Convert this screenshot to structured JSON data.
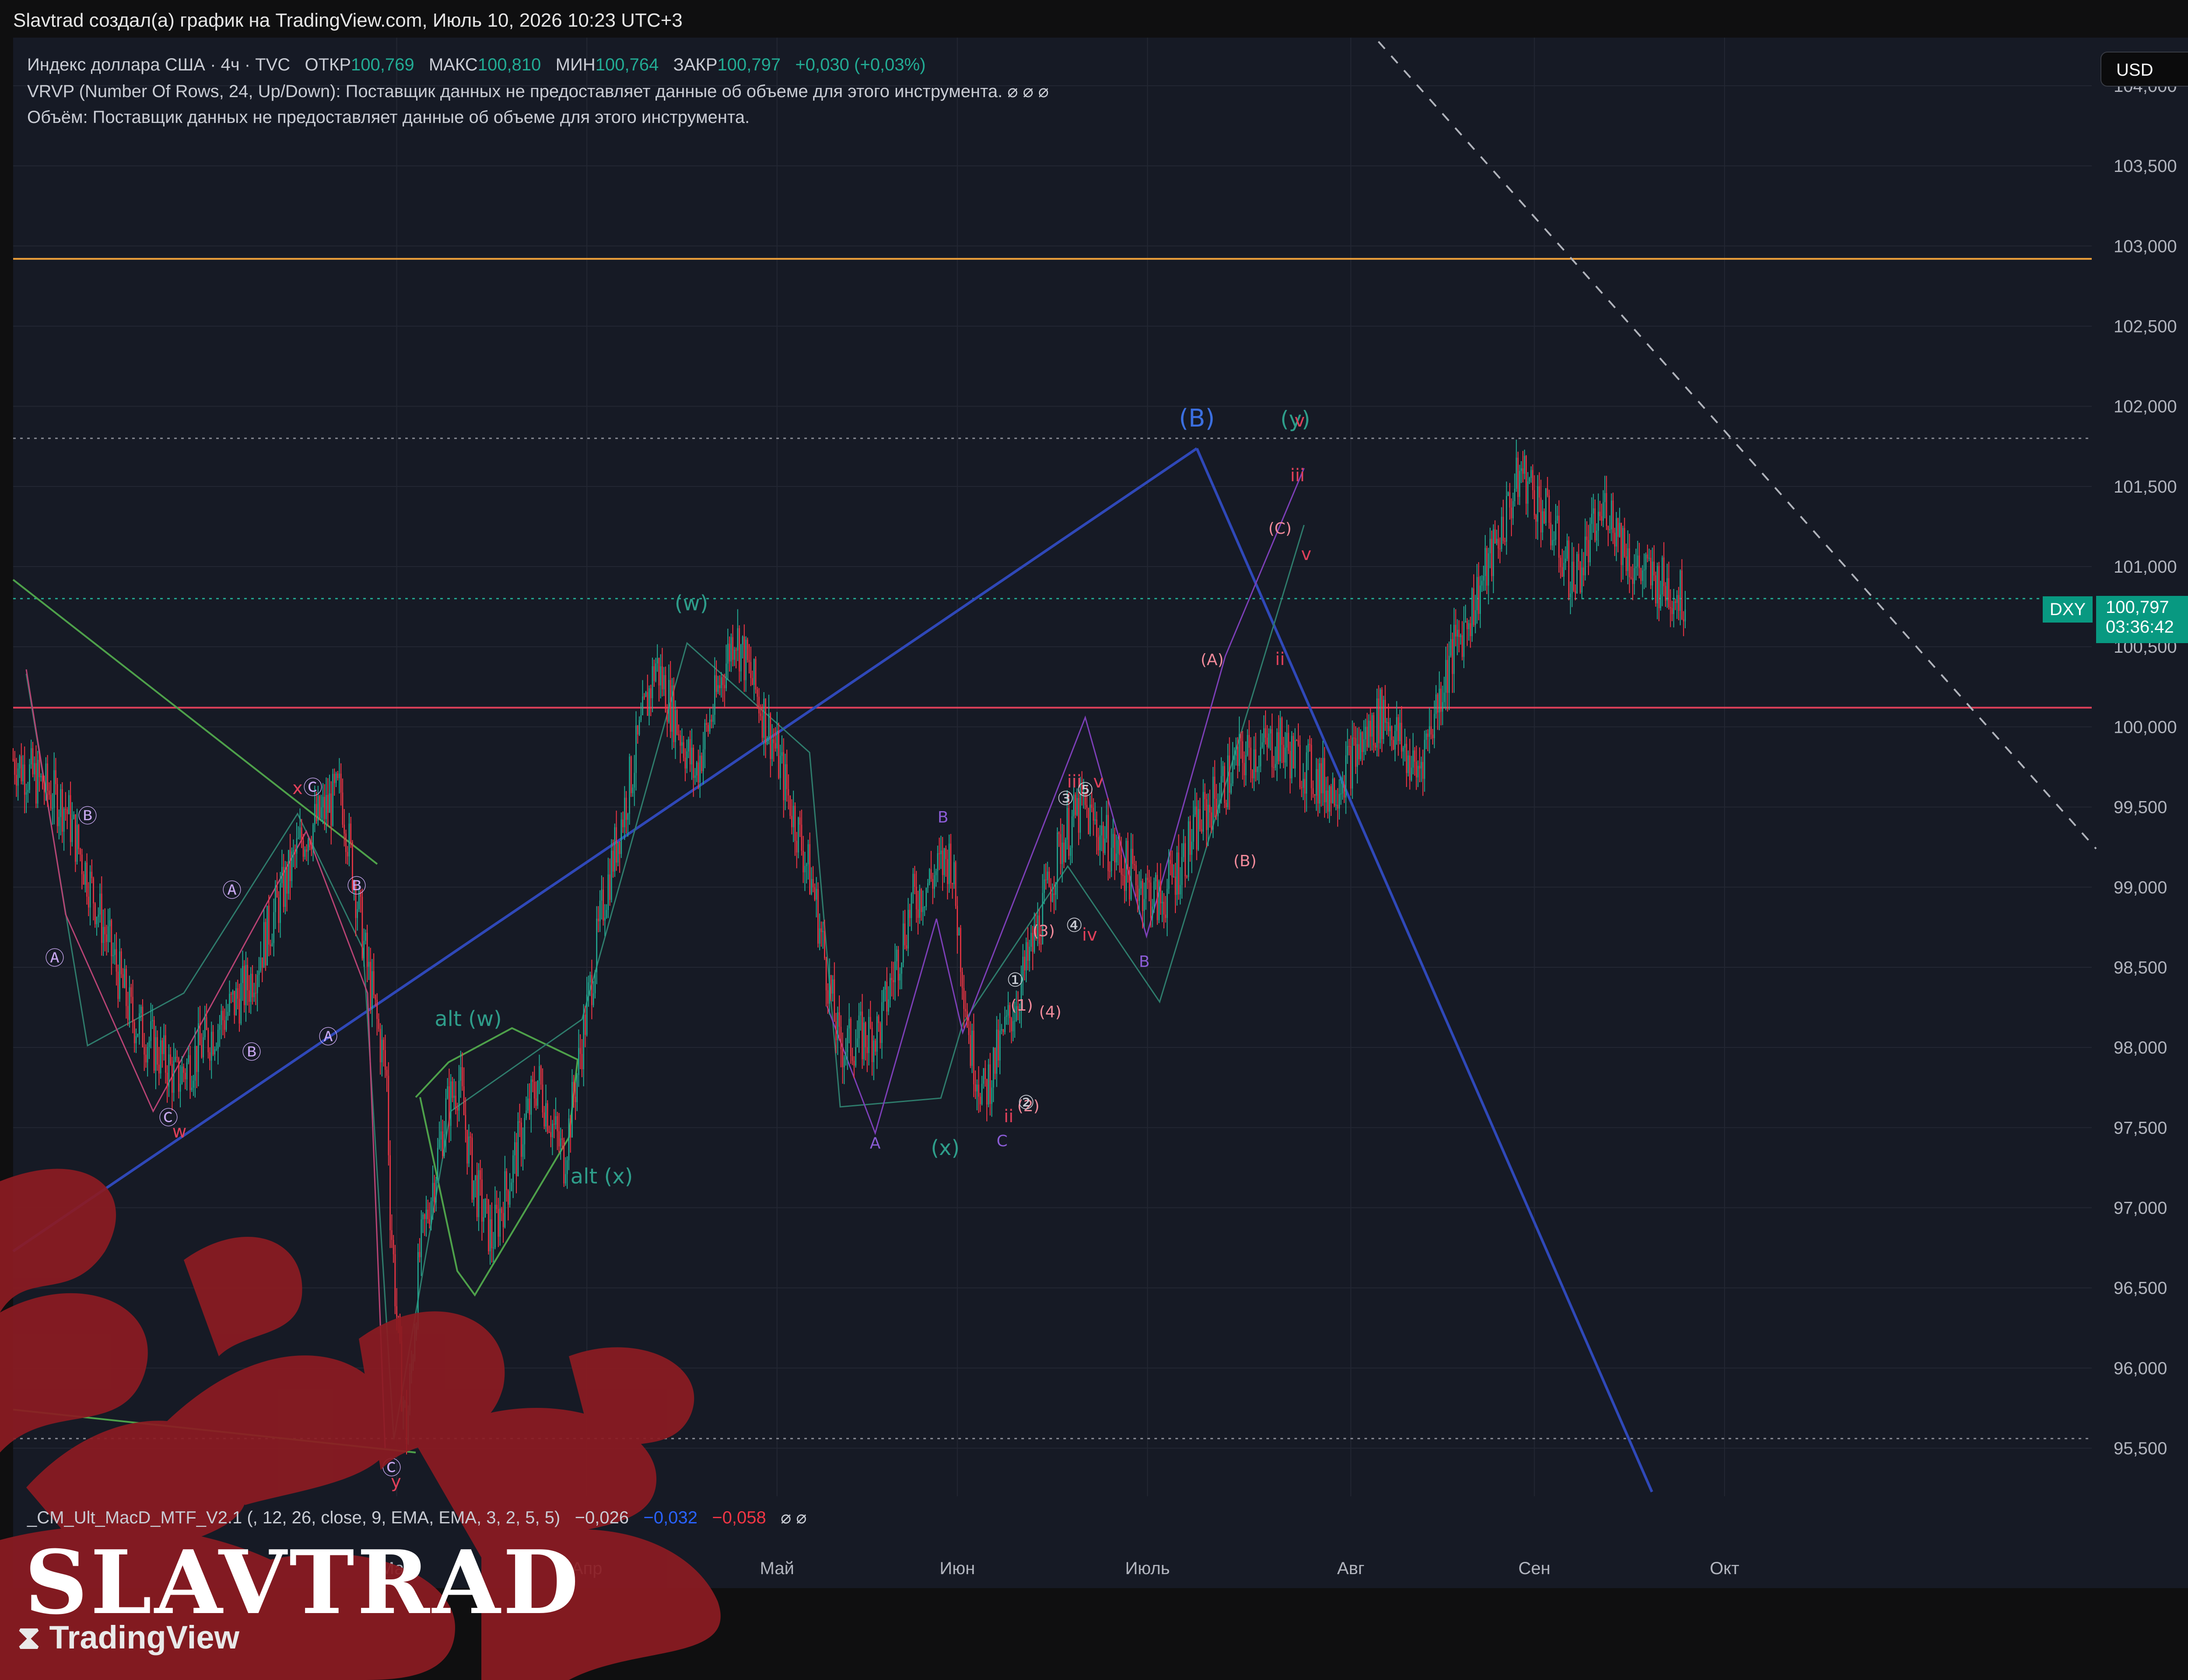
{
  "attribution": "Slavtrad создал(а) график на TradingView.com, Июль 10, 2026 10:23 UTC+3",
  "legend": {
    "symbol": "Индекс доллара США · 4ч · TVC",
    "open_label": "ОТКР",
    "open": "100,769",
    "high_label": "МАКС",
    "high": "100,810",
    "low_label": "МИН",
    "low": "100,764",
    "close_label": "ЗАКР",
    "close": "100,797",
    "change": "+0,030 (+0,03%)",
    "vrvp": "VRVP (Number Of Rows, 24, Up/Down): Поставщик данных не предоставляет данные об объеме для этого инструмента. ⌀ ⌀ ⌀",
    "volume": "Объём: Поставщик данных не предоставляет данные об объеме для этого инструмента."
  },
  "currency": "USD",
  "ticker": "DXY",
  "last_price": "100,797",
  "countdown": "03:36:42",
  "macd": {
    "label": "_CM_Ult_MacD_MTF_V2.1 (, 12, 26, close, 9, EMA, EMA, 3, 2, 5, 5)",
    "v1": "−0,026",
    "v2": "−0,032",
    "v3": "−0,058",
    "tail": "⌀ ⌀"
  },
  "watermark": "SLAVTRAD",
  "platform": "TradingView",
  "chart_data": {
    "type": "candlestick",
    "symbol": "DXY",
    "timeframe": "4ч",
    "ylim": [
      95.2,
      104.3
    ],
    "y_ticks": [
      "95,500",
      "96,000",
      "96,500",
      "97,000",
      "97,500",
      "98,000",
      "98,500",
      "99,000",
      "99,500",
      "100,000",
      "100,500",
      "101,000",
      "101,500",
      "102,000",
      "102,500",
      "103,000",
      "103,500",
      "104,000"
    ],
    "y_tick_values": [
      95.5,
      96,
      96.5,
      97,
      97.5,
      98,
      98.5,
      99,
      99.5,
      100,
      100.5,
      101,
      101.5,
      102,
      102.5,
      103,
      103.5,
      104
    ],
    "x_ticks": [
      "Мар",
      "Апр",
      "Май",
      "Июн",
      "Июль",
      "Авг",
      "Сен",
      "Окт"
    ],
    "x_tick_index": [
      58.5,
      87.5,
      116.5,
      144,
      173,
      204,
      232,
      261
    ],
    "x_range": [
      0,
      317
    ],
    "price_path_knots": [
      [
        0,
        99.8
      ],
      [
        8,
        99.5
      ],
      [
        18,
        98.2
      ],
      [
        25,
        97.8
      ],
      [
        36,
        98.4
      ],
      [
        44,
        99.3
      ],
      [
        50,
        99.6
      ],
      [
        54,
        98.5
      ],
      [
        57,
        97.8
      ],
      [
        57.5,
        97.0
      ],
      [
        59,
        96.0
      ],
      [
        60,
        95.6
      ],
      [
        62,
        96.7
      ],
      [
        66,
        97.6
      ],
      [
        68,
        97.8
      ],
      [
        70,
        97.2
      ],
      [
        73,
        96.8
      ],
      [
        80,
        97.8
      ],
      [
        84,
        97.3
      ],
      [
        90,
        98.9
      ],
      [
        98,
        100.4
      ],
      [
        104,
        99.7
      ],
      [
        110,
        100.6
      ],
      [
        116,
        99.9
      ],
      [
        122,
        99.0
      ],
      [
        126,
        98.0
      ],
      [
        132,
        98.1
      ],
      [
        137,
        98.9
      ],
      [
        143,
        99.2
      ],
      [
        146,
        98.0
      ],
      [
        148,
        97.7
      ],
      [
        153,
        98.3
      ],
      [
        156,
        98.7
      ],
      [
        160,
        99.3
      ],
      [
        163,
        99.5
      ],
      [
        170,
        99.1
      ],
      [
        175,
        98.9
      ],
      [
        181,
        99.4
      ],
      [
        187,
        99.8
      ],
      [
        193,
        99.9
      ],
      [
        201,
        99.6
      ],
      [
        209,
        100.1
      ],
      [
        214,
        99.7
      ],
      [
        219,
        100.4
      ],
      [
        225,
        101.0
      ],
      [
        230,
        101.6
      ],
      [
        234,
        101.3
      ],
      [
        238,
        100.9
      ],
      [
        243,
        101.4
      ],
      [
        247,
        101.0
      ],
      [
        255,
        100.8
      ]
    ],
    "horizontal_levels": [
      {
        "value": 102.92,
        "color": "#f2a33a"
      },
      {
        "value": 100.12,
        "color": "#e0405a"
      },
      {
        "value": 101.8,
        "style": "dotted"
      },
      {
        "value": 100.8,
        "style": "dotted",
        "color": "#22ab94"
      },
      {
        "value": 95.56,
        "style": "dotted"
      }
    ],
    "wave_labels": [
      "(B)",
      "(y)",
      "(w)",
      "(x)",
      "alt (w)",
      "alt (x)",
      "(A)",
      "(B)",
      "(C)",
      "A",
      "B",
      "C",
      "x",
      "w",
      "y",
      "ii",
      "iii",
      "iv",
      "v",
      "(1)",
      "(2)",
      "(3)",
      "(4)",
      "Ⓐ",
      "Ⓑ",
      "Ⓒ",
      "①",
      "②",
      "③",
      "④",
      "⑤"
    ]
  }
}
